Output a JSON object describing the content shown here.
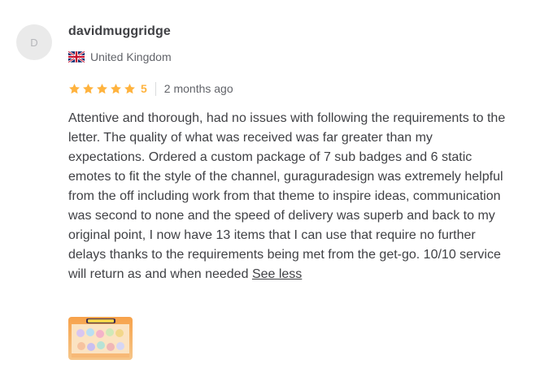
{
  "review": {
    "avatar_initial": "D",
    "username": "davidmuggridge",
    "country": "United Kingdom",
    "country_flag_icon": "uk-flag-icon",
    "rating": 5,
    "rating_label": "5",
    "star_color": "#ffb33e",
    "time_ago": "2 months ago",
    "body": "Attentive and thorough, had no issues with following the requirements to the letter. The quality of what was received was far greater than my expectations. Ordered a custom package of 7 sub badges and 6 static emotes to fit the style of the channel, guraguradesign was extremely helpful from the off including work from that theme to inspire ideas, communication was second to none and the speed of delivery was superb and back to my original point, I now have 13 items that I can use that require no further delays thanks to the requirements being met from the get-go. 10/10 service will return as and when needed",
    "see_less_label": "See less"
  }
}
